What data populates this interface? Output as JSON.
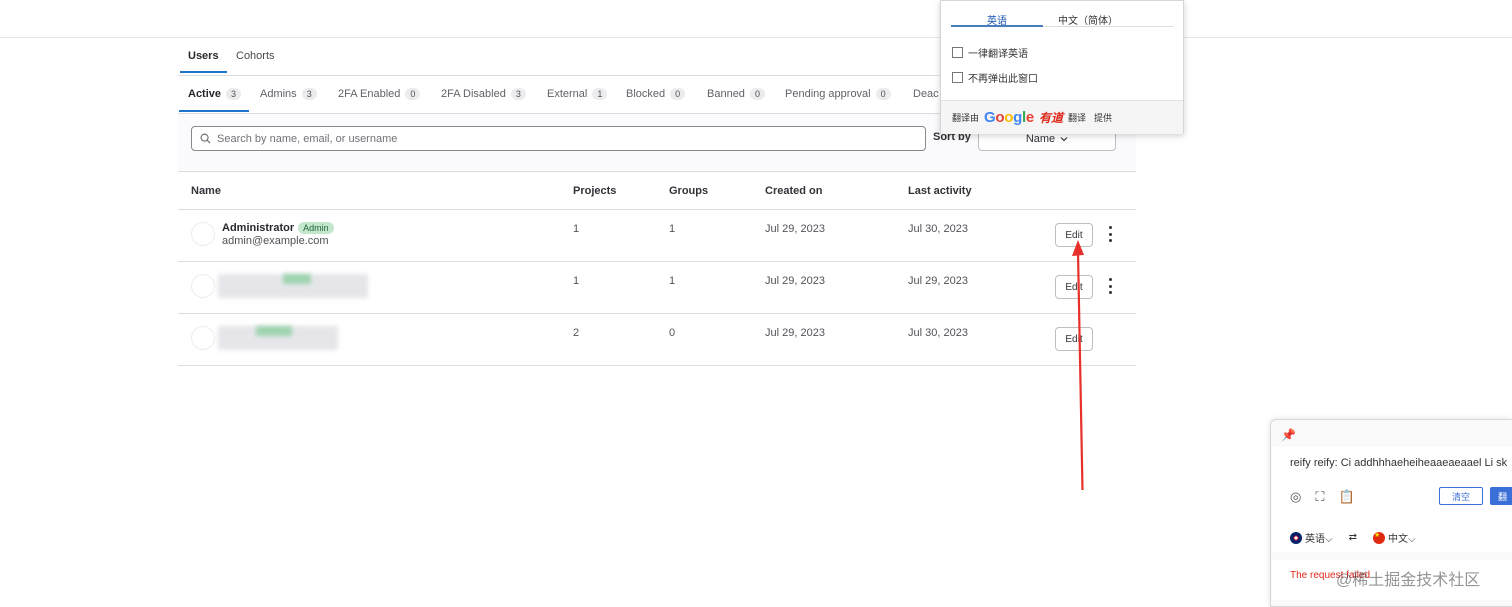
{
  "tabs": {
    "users": "Users",
    "cohorts": "Cohorts"
  },
  "status_tabs": [
    {
      "label": "Active",
      "count": "3"
    },
    {
      "label": "Admins",
      "count": "3"
    },
    {
      "label": "2FA Enabled",
      "count": "0"
    },
    {
      "label": "2FA Disabled",
      "count": "3"
    },
    {
      "label": "External",
      "count": "1"
    },
    {
      "label": "Blocked",
      "count": "0"
    },
    {
      "label": "Banned",
      "count": "0"
    },
    {
      "label": "Pending approval",
      "count": "0"
    },
    {
      "label": "Deac"
    }
  ],
  "search": {
    "placeholder": "Search by name, email, or username"
  },
  "sort": {
    "label": "Sort by",
    "value": "Name"
  },
  "table": {
    "headers": {
      "name": "Name",
      "projects": "Projects",
      "groups": "Groups",
      "created": "Created on",
      "activity": "Last activity"
    },
    "rows": [
      {
        "name": "Administrator",
        "badge": "Admin",
        "email": "admin@example.com",
        "projects": "1",
        "groups": "1",
        "created": "Jul 29, 2023",
        "activity": "Jul 30, 2023",
        "edit": "Edit"
      },
      {
        "projects": "1",
        "groups": "1",
        "created": "Jul 29, 2023",
        "activity": "Jul 29, 2023",
        "edit": "Edit"
      },
      {
        "projects": "2",
        "groups": "0",
        "created": "Jul 29, 2023",
        "activity": "Jul 30, 2023",
        "edit": "Edit"
      }
    ]
  },
  "translate_popup": {
    "tab_en": "英语",
    "tab_zh": "中文（简体）",
    "always_translate": "一律翻译英语",
    "never_popup": "不再弹出此窗口",
    "footer_prefix": "翻译由",
    "youdao": "有道",
    "footer_mid": "翻译",
    "footer_suffix": "提供"
  },
  "translate_panel": {
    "input_text": "reify reify:  Ci addhhhaeheiheaaeaeaael Li sk",
    "clear": "清空",
    "translate": "翻",
    "source_lang": "英语",
    "target_lang": "中文",
    "error": "The request failed"
  },
  "watermark": "@稀土掘金技术社区",
  "colors": {
    "accent": "#1f75cb",
    "admin_badge_bg": "#c3e6cd",
    "arrow": "#e8302a",
    "youdao": "#e0281b"
  }
}
